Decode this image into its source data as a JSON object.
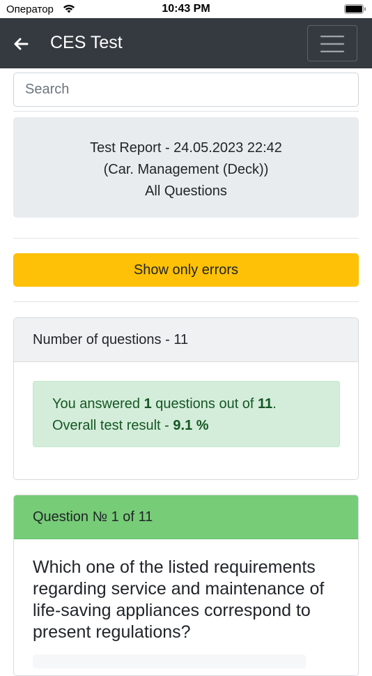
{
  "status_bar": {
    "carrier": "Оператор",
    "time": "10:43 PM"
  },
  "navbar": {
    "title": "CES Test",
    "back_icon": "arrow-left-icon",
    "menu_icon": "hamburger-icon"
  },
  "search": {
    "placeholder": "Search",
    "value": ""
  },
  "report": {
    "line1": "Test Report - 24.05.2023 22:42",
    "line2": "(Car. Management (Deck))",
    "line3": "All Questions"
  },
  "errors_button": {
    "label": "Show only errors"
  },
  "summary": {
    "header": "Number of questions - 11",
    "answered_prefix": "You answered ",
    "answered_count": "1",
    "answered_middle": " questions out of ",
    "total_count": "11",
    "answered_suffix": ".",
    "result_prefix": "Overall test result - ",
    "result_value": "9.1 %"
  },
  "question": {
    "header": "Question № 1 of 11",
    "text": "Which one of the listed requirements regarding service and maintenance of life-saving appliances correspond to present regulations?"
  },
  "colors": {
    "navbar": "#343a40",
    "warning": "#ffc107",
    "success_bg": "#d4edda",
    "success_text": "#155724",
    "question_header": "#77cc77"
  }
}
